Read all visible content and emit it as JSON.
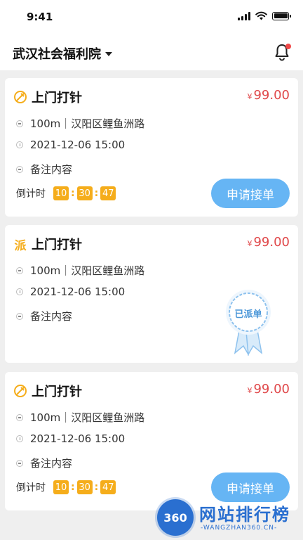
{
  "status_bar": {
    "time": "9:41"
  },
  "header": {
    "title": "武汉社会福利院"
  },
  "orders": [
    {
      "type_icon": "injection-badge-icon",
      "title": "上门打针",
      "currency": "¥",
      "price": "99.00",
      "location": "100m｜汉阳区鲤鱼洲路",
      "datetime": "2021-12-06 15:00",
      "note": "备注内容",
      "countdown_label": "倒计时",
      "countdown": {
        "h": "10",
        "m": "30",
        "s": "47"
      },
      "action_label": "申请接单"
    },
    {
      "type_icon_text": "派",
      "title": "上门打针",
      "currency": "¥",
      "price": "99.00",
      "location": "100m｜汉阳区鲤鱼洲路",
      "datetime": "2021-12-06 15:00",
      "note": "备注内容",
      "stamp_label": "已派单"
    },
    {
      "type_icon": "injection-badge-icon",
      "title": "上门打针",
      "currency": "¥",
      "price": "99.00",
      "location": "100m｜汉阳区鲤鱼洲路",
      "datetime": "2021-12-06 15:00",
      "note": "备注内容",
      "countdown_label": "倒计时",
      "countdown": {
        "h": "10",
        "m": "30",
        "s": "47"
      },
      "action_label": "申请接单"
    }
  ],
  "watermark": {
    "logo_text": "360",
    "name": "网站排行榜",
    "url": "-WANGZHAN360.CN-"
  },
  "colors": {
    "price": "#e0484a",
    "accent_button": "#66b5f4",
    "countdown": "#f5ad1b",
    "badge": "#f04848"
  }
}
